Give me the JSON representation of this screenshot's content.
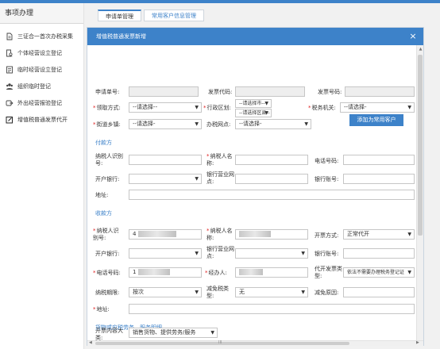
{
  "sidebar": {
    "title": "事项办理",
    "items": [
      {
        "label": "三证合一首次办税采集",
        "icon": "document-icon"
      },
      {
        "label": "个体经营设立登记",
        "icon": "person-document-icon"
      },
      {
        "label": "临时经营设立登记",
        "icon": "form-icon"
      },
      {
        "label": "组织临时登记",
        "icon": "group-icon"
      },
      {
        "label": "外出经营报验登记",
        "icon": "export-icon"
      },
      {
        "label": "增值税普通发票代开",
        "icon": "edit-icon"
      }
    ]
  },
  "tabs": {
    "tab1": "申请单管理",
    "tab2": "常用客户信息管理"
  },
  "dialog": {
    "title": "增值税普通发票新增",
    "close": "×"
  },
  "form": {
    "apply_no": "申请单号:",
    "invoice_code": "发票代码:",
    "invoice_no": "发票号码:",
    "pickup": "领取方式:",
    "pickup_val": "--请选择--",
    "region": "行政区划:",
    "region_city": "--请选择市--",
    "region_district": "--请选择区县--",
    "tax_office": "税务机关:",
    "tax_office_val": "--请选择-",
    "street": "街道乡镇:",
    "street_val": "--请选择-",
    "office_point": "办税网点:",
    "office_point_val": "--请选择-"
  },
  "payer": {
    "section": "付款方",
    "add_button": "添加为常用客户",
    "tax_id": "纳税人识别号:",
    "name": "纳税人名称:",
    "phone": "电话号码:",
    "bank": "开户银行:",
    "branch": "银行营业网点:",
    "account": "银行账号:",
    "address": "地址:"
  },
  "payee": {
    "section": "收款方",
    "tax_id": "纳税人识别号:",
    "tax_id_prefix": "4",
    "name": "纳税人名称:",
    "issue_type": "开票方式:",
    "issue_type_val": "正常代开",
    "bank": "开户银行:",
    "branch": "银行营业网点:",
    "account": "银行账号:",
    "phone": "电话号码:",
    "phone_prefix": "1",
    "agent": "经办人:",
    "agent_type": "代开发票类型:",
    "agent_type_val": "依法不需要办理税务登记证",
    "period": "纳税期限:",
    "period_val": "按次",
    "reduce_type": "减免税类型:",
    "reduce_type_val": "无",
    "reduce_reason": "减免原因:",
    "address": "地址:"
  },
  "goods": {
    "section": "货物或应税劳务、服务明细",
    "category": "开票内容大类:",
    "category_val": "销售货物、提供劳务/服务"
  },
  "scroll": {
    "h_label": "III"
  }
}
